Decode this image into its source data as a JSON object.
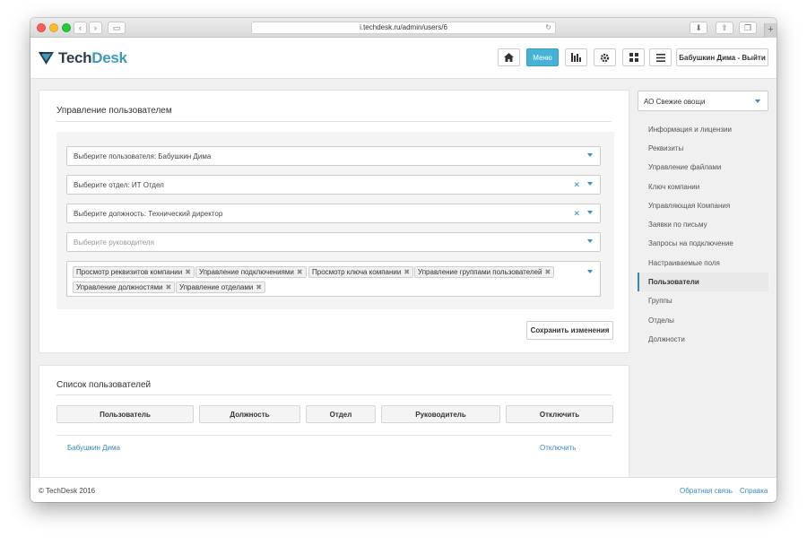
{
  "browser": {
    "url": "i.techdesk.ru/admin/users/6"
  },
  "header": {
    "logo_tech": "Tech",
    "logo_desk": "Desk",
    "menu_label": "Меню",
    "user_label": "Бабушкин Дима - Выйти"
  },
  "user_panel": {
    "title": "Управление пользователем",
    "user_select": "Выберите пользователя: Бабушкин Дима",
    "department_select": "Выберите отдел: ИТ Отдел",
    "position_select": "Выберите должность: Технический директор",
    "manager_placeholder": "Выберите руководителя",
    "permissions": [
      "Просмотр реквизитов компании",
      "Управление подключениями",
      "Просмотр ключа компании",
      "Управление группами пользователей",
      "Управление должностями",
      "Управление отделами"
    ],
    "save_label": "Сохранить изменения"
  },
  "users_list": {
    "title": "Список пользователей",
    "columns": [
      "Пользователь",
      "Должность",
      "Отдел",
      "Руководитель",
      "Отключить"
    ],
    "rows": [
      {
        "user": "Бабушкин Дима",
        "action": "Отключить"
      }
    ]
  },
  "sidebar": {
    "company": "АО Свежие овощи",
    "items": [
      "Информация и лицензии",
      "Реквизиты",
      "Управление файлами",
      "Ключ компании",
      "Управляющая Компания",
      "Заявки по письму",
      "Запросы на подключение",
      "Настраиваемые поля",
      "Пользователи",
      "Группы",
      "Отделы",
      "Должности"
    ],
    "active_item": "Пользователи"
  },
  "footer": {
    "copyright": "© TechDesk 2016",
    "feedback": "Обратная связь",
    "help": "Справка"
  },
  "colors": {
    "accent": "#46b2d6",
    "link": "#3b87b8"
  }
}
